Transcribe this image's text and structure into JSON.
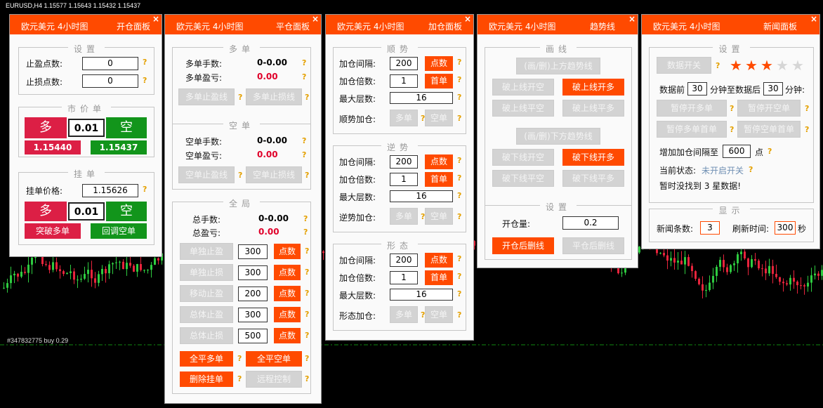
{
  "chart": {
    "symbol_line": "EURUSD,H4  1.15577 1.15643 1.15432 1.15437",
    "order_label": "#347832775 buy 0.29"
  },
  "colors": {
    "accent": "#ff4a00",
    "sell_red": "#dc1f45",
    "buy_green": "#12951b",
    "value_red": "#e0002a",
    "help": "#e4a000"
  },
  "help_mark": "?",
  "close_glyph": "×",
  "p1": {
    "title_left": "欧元美元 4小时图",
    "title_right": "开仓面板",
    "settings": {
      "legend": "设置",
      "tp_label": "止盈点数:",
      "tp_value": "0",
      "sl_label": "止损点数:",
      "sl_value": "0"
    },
    "market": {
      "legend": "市价单",
      "sell_label": "多",
      "lot": "0.01",
      "buy_label": "空",
      "sell_price": "1.15440",
      "buy_price": "1.15437"
    },
    "pending": {
      "legend": "挂单",
      "price_label": "挂单价格:",
      "price_value": "1.15626",
      "sell_label": "多",
      "lot": "0.01",
      "buy_label": "空",
      "breakout_label": "突破多单",
      "pullback_label": "回调空单"
    }
  },
  "p2": {
    "title_left": "欧元美元 4小时图",
    "title_right": "平仓面板",
    "long": {
      "legend": "多单",
      "lots_label": "多单手数:",
      "lots_value": "0-0.00",
      "pl_label": "多单盈亏:",
      "pl_value": "0.00",
      "tp_btn": "多单止盈线",
      "sl_btn": "多单止损线"
    },
    "short": {
      "legend": "空单",
      "lots_label": "空单手数:",
      "lots_value": "0-0.00",
      "pl_label": "空单盈亏:",
      "pl_value": "0.00",
      "tp_btn": "空单止盈线",
      "sl_btn": "空单止损线"
    },
    "global": {
      "legend": "全局",
      "lots_label": "总手数:",
      "lots_value": "0-0.00",
      "pl_label": "总盈亏:",
      "pl_value": "0.00",
      "rows": [
        {
          "btn": "单独止盈",
          "value": "300",
          "unit": "点数"
        },
        {
          "btn": "单独止损",
          "value": "300",
          "unit": "点数"
        },
        {
          "btn": "移动止盈",
          "value": "200",
          "unit": "点数"
        },
        {
          "btn": "总体止盈",
          "value": "300",
          "unit": "点数"
        },
        {
          "btn": "总体止损",
          "value": "500",
          "unit": "点数"
        }
      ],
      "close_long": "全平多单",
      "close_short": "全平空单",
      "delete_pending": "删除挂单",
      "remote": "远程控制"
    }
  },
  "p3": {
    "title_left": "欧元美元 4小时图",
    "title_right": "加仓面板",
    "sections": [
      {
        "legend": "顺势",
        "interval_label": "加仓间隔:",
        "interval": "200",
        "interval_unit": "点数",
        "mult_label": "加仓倍数:",
        "mult": "1",
        "mult_unit": "首单",
        "layers_label": "最大层数:",
        "layers": "16",
        "add_label": "顺势加仓:",
        "long_btn": "多单",
        "short_btn": "空单"
      },
      {
        "legend": "逆势",
        "interval_label": "加仓间隔:",
        "interval": "200",
        "interval_unit": "点数",
        "mult_label": "加仓倍数:",
        "mult": "1",
        "mult_unit": "首单",
        "layers_label": "最大层数:",
        "layers": "16",
        "add_label": "逆势加仓:",
        "long_btn": "多单",
        "short_btn": "空单"
      },
      {
        "legend": "形态",
        "interval_label": "加仓间隔:",
        "interval": "200",
        "interval_unit": "点数",
        "mult_label": "加仓倍数:",
        "mult": "1",
        "mult_unit": "首单",
        "layers_label": "最大层数:",
        "layers": "16",
        "add_label": "形态加仓:",
        "long_btn": "多单",
        "short_btn": "空单"
      }
    ]
  },
  "p4": {
    "title_left": "欧元美元 4小时图",
    "title_right": "趋势线",
    "draw": {
      "legend": "画线",
      "upper_draw": "(画/删)上方趋势线",
      "up_open_short": "破上线开空",
      "up_open_long": "破上线开多",
      "up_close_short": "破上线平空",
      "up_close_long": "破上线平多",
      "lower_draw": "(画/删)下方趋势线",
      "dn_open_short": "破下线开空",
      "dn_open_long": "破下线开多",
      "dn_close_short": "破下线平空",
      "dn_close_long": "破下线平多"
    },
    "settings": {
      "legend": "设置",
      "lot_label": "开仓量:",
      "lot_value": "0.2",
      "open_delete": "开仓后删线",
      "close_delete": "平仓后删线"
    }
  },
  "p5": {
    "title_left": "欧元美元 4小时图",
    "title_right": "新闻面板",
    "settings": {
      "legend": "设置",
      "data_switch": "数据开关",
      "stars_filled": 3,
      "stars_total": 5,
      "before_label": "数据前",
      "before_value": "30",
      "mid_label": "分钟至数据后",
      "after_value": "30",
      "after_label": "分钟:",
      "pause_long_open": "暂停开多单",
      "pause_short_open": "暂停开空单",
      "pause_long_first": "暂停多单首单",
      "pause_short_first": "暂停空单首单",
      "interval_label": "增加加仓间隔至",
      "interval_value": "600",
      "interval_unit": "点",
      "status_label": "当前状态:",
      "status_value": "未开启开关",
      "no_data": "暂时没找到 3 星数据!"
    },
    "display": {
      "legend": "显示",
      "count_label": "新闻条数:",
      "count_value": "3",
      "refresh_label": "刷新时间:",
      "refresh_value": "300",
      "refresh_unit": "秒"
    }
  }
}
